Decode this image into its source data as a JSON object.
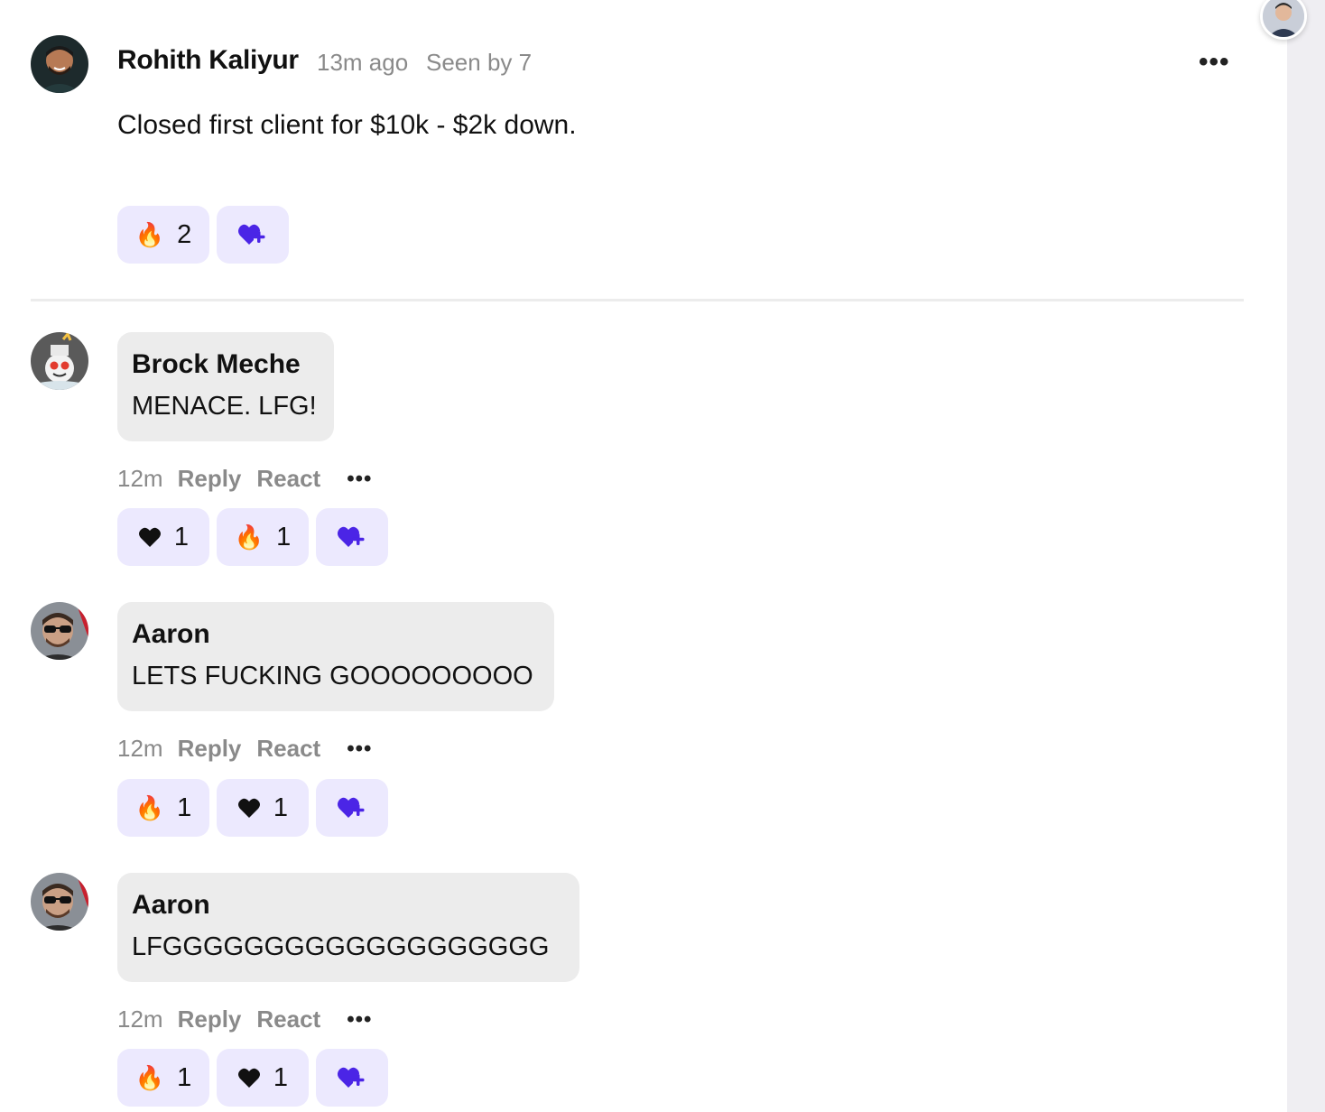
{
  "post": {
    "author": "Rohith Kaliyur",
    "time": "13m ago",
    "seen": "Seen by 7",
    "menu": "•••",
    "body": "Closed first client for $10k - $2k down.",
    "reactions": [
      {
        "icon": "fire-icon",
        "emoji": "🔥",
        "count": "2"
      }
    ]
  },
  "comments": [
    {
      "author": "Brock Meche",
      "message": "MENACE. LFG!",
      "time": "12m",
      "reply_label": "Reply",
      "react_label": "React",
      "menu": "•••",
      "reactions": [
        {
          "icon": "heart-icon",
          "count": "1"
        },
        {
          "icon": "fire-icon",
          "emoji": "🔥",
          "count": "1"
        }
      ]
    },
    {
      "author": "Aaron",
      "message": "LETS FUCKING GOOOOOOOOO",
      "time": "12m",
      "reply_label": "Reply",
      "react_label": "React",
      "menu": "•••",
      "reactions": [
        {
          "icon": "fire-icon",
          "emoji": "🔥",
          "count": "1"
        },
        {
          "icon": "heart-icon",
          "count": "1"
        }
      ]
    },
    {
      "author": "Aaron",
      "message": "LFGGGGGGGGGGGGGGGGGGG",
      "time": "12m",
      "reply_label": "Reply",
      "react_label": "React",
      "menu": "•••",
      "reactions": [
        {
          "icon": "fire-icon",
          "emoji": "🔥",
          "count": "1"
        },
        {
          "icon": "heart-icon",
          "count": "1"
        }
      ]
    }
  ],
  "colors": {
    "chip_bg": "#ece9fe",
    "accent": "#4b25e6",
    "bubble_bg": "#ececec",
    "muted_text": "#8a8a8a"
  }
}
